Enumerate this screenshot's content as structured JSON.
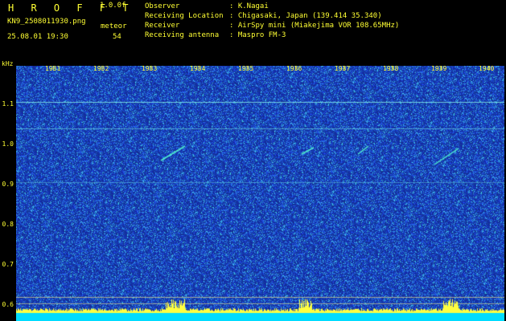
{
  "header": {
    "brand": "H R O F F T",
    "version": "1.0.0f",
    "filename": "KN9_2508011930.png",
    "datetime": "25.08.01 19:30",
    "meteor_label": "meteor",
    "meteor_count": "54"
  },
  "info": [
    {
      "key": "Observer",
      "value": ": K.Nagai"
    },
    {
      "key": "Receiving Location",
      "value": ": Chigasaki, Japan (139.414 35.340)"
    },
    {
      "key": "Receiver",
      "value": ": AirSpy mini (Miakejima VOR 108.65MHz)"
    },
    {
      "key": "Receiving antenna",
      "value": ": Maspro FM-3"
    }
  ],
  "axis": {
    "unit": "kHz",
    "y_ticks": [
      "1.1",
      "1.0",
      "0.9",
      "0.8",
      "0.7",
      "0.6"
    ],
    "time_ticks": [
      "1931",
      "1932",
      "1933",
      "1934",
      "1935",
      "1936",
      "1937",
      "1938",
      "1939",
      "1940"
    ]
  },
  "colors": {
    "background": "#1c2fa0",
    "text": "#ffff33",
    "signal": "#40e0e8",
    "noise_floor": "#00e0ff"
  }
}
